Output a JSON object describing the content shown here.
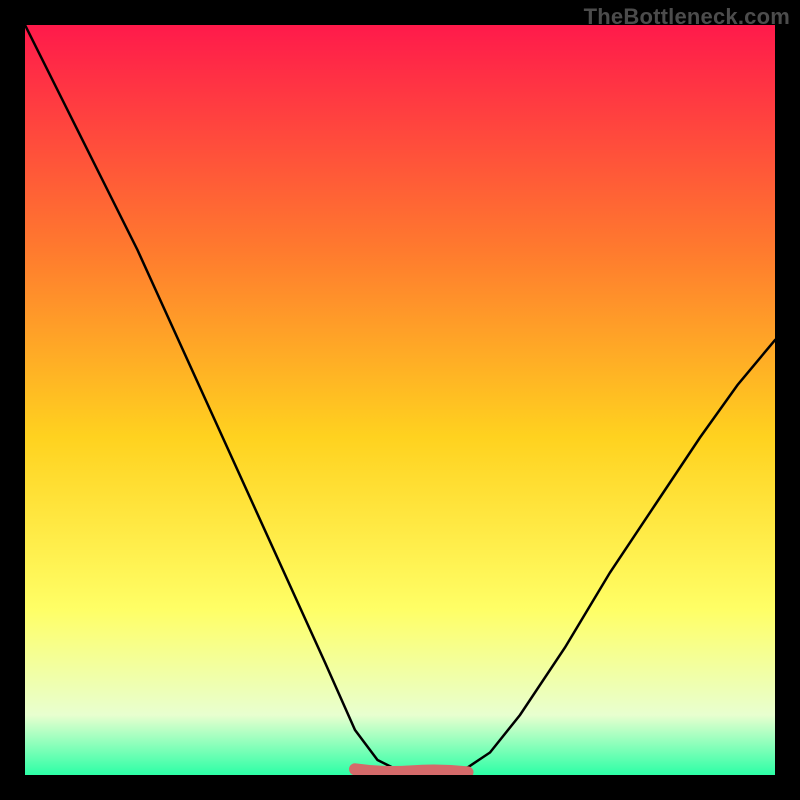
{
  "watermark": "TheBottleneck.com",
  "colors": {
    "frame": "#000000",
    "grad_top": "#ff1a4b",
    "grad_mid1": "#ff7a2e",
    "grad_mid2": "#ffd21f",
    "grad_mid3": "#ffff66",
    "grad_bot_above": "#e8ffcf",
    "grad_bot": "#2cffa6",
    "curve_black": "#000000",
    "valley_mark": "#d46a6a"
  },
  "chart_data": {
    "type": "line",
    "title": "",
    "xlabel": "",
    "ylabel": "",
    "xlim": [
      0,
      100
    ],
    "ylim": [
      0,
      100
    ],
    "series": [
      {
        "name": "bottleneck-curve",
        "x": [
          0,
          5,
          10,
          15,
          20,
          25,
          30,
          35,
          40,
          44,
          47,
          50,
          53,
          56,
          59,
          62,
          66,
          72,
          78,
          84,
          90,
          95,
          100
        ],
        "y": [
          100,
          90,
          80,
          70,
          59,
          48,
          37,
          26,
          15,
          6,
          2,
          0.5,
          0.5,
          0.5,
          1,
          3,
          8,
          17,
          27,
          36,
          45,
          52,
          58
        ]
      }
    ],
    "valley_marker": {
      "x_start": 44,
      "x_end": 59,
      "y": 0.5
    }
  }
}
